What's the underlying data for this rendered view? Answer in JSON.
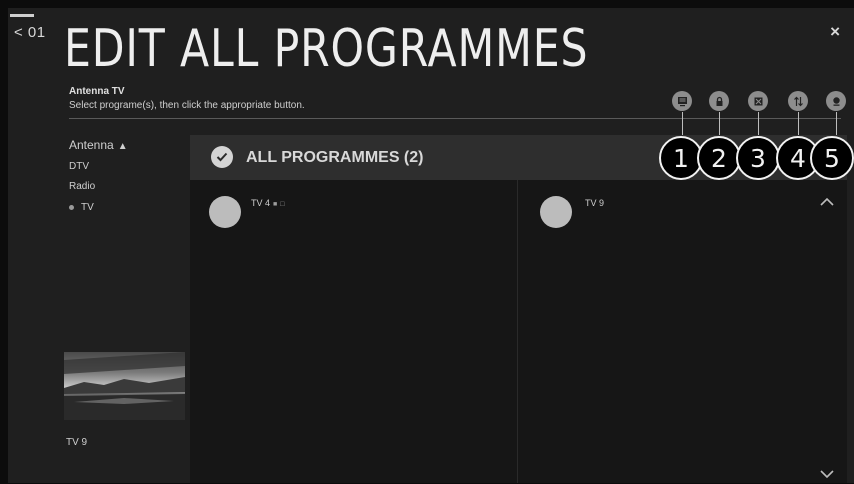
{
  "header": {
    "back_label": "< 01",
    "close_label": "×",
    "title": "EDIT ALL PROGRAMMES",
    "subtitle": "Antenna TV",
    "instruction": "Select programe(s), then click the appropriate button."
  },
  "toolbar": {
    "buttons": [
      {
        "icon": "list-icon"
      },
      {
        "icon": "lock-icon"
      },
      {
        "icon": "skip-icon"
      },
      {
        "icon": "sort-icon"
      },
      {
        "icon": "delete-icon"
      }
    ]
  },
  "callouts": [
    "1",
    "2",
    "3",
    "4",
    "5"
  ],
  "sidebar": {
    "group_label": "Antenna",
    "items": [
      {
        "label": "DTV",
        "selected": false
      },
      {
        "label": "Radio",
        "selected": false
      },
      {
        "label": "TV",
        "selected": true
      }
    ],
    "preview_label": "TV 9"
  },
  "main": {
    "header_title": "ALL PROGRAMMES (2)",
    "channels": [
      {
        "name": "TV 4",
        "icons": [
          "lock-icon",
          "skip-icon"
        ]
      },
      {
        "name": "TV 9",
        "icons": []
      }
    ]
  },
  "colors": {
    "background": "#1f1f1f",
    "header_row": "#2e2e2e",
    "panel": "#161616",
    "accent": "#d4d4d4"
  }
}
